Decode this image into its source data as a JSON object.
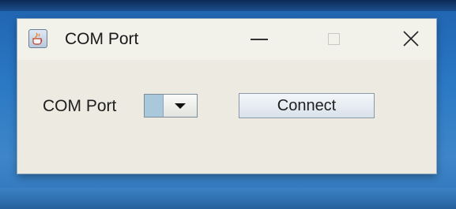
{
  "window": {
    "title": "COM Port",
    "icon": "java-cup-icon",
    "controls": {
      "minimize_icon": "minimize-icon",
      "maximize_icon": "maximize-icon",
      "close_icon": "close-icon"
    }
  },
  "form": {
    "port_label": "COM Port",
    "port_select_value": "",
    "connect_label": "Connect"
  },
  "colors": {
    "desktop": "#2b78c4",
    "window_bg": "#eceae1",
    "combo_selection": "#a9c8dc"
  }
}
